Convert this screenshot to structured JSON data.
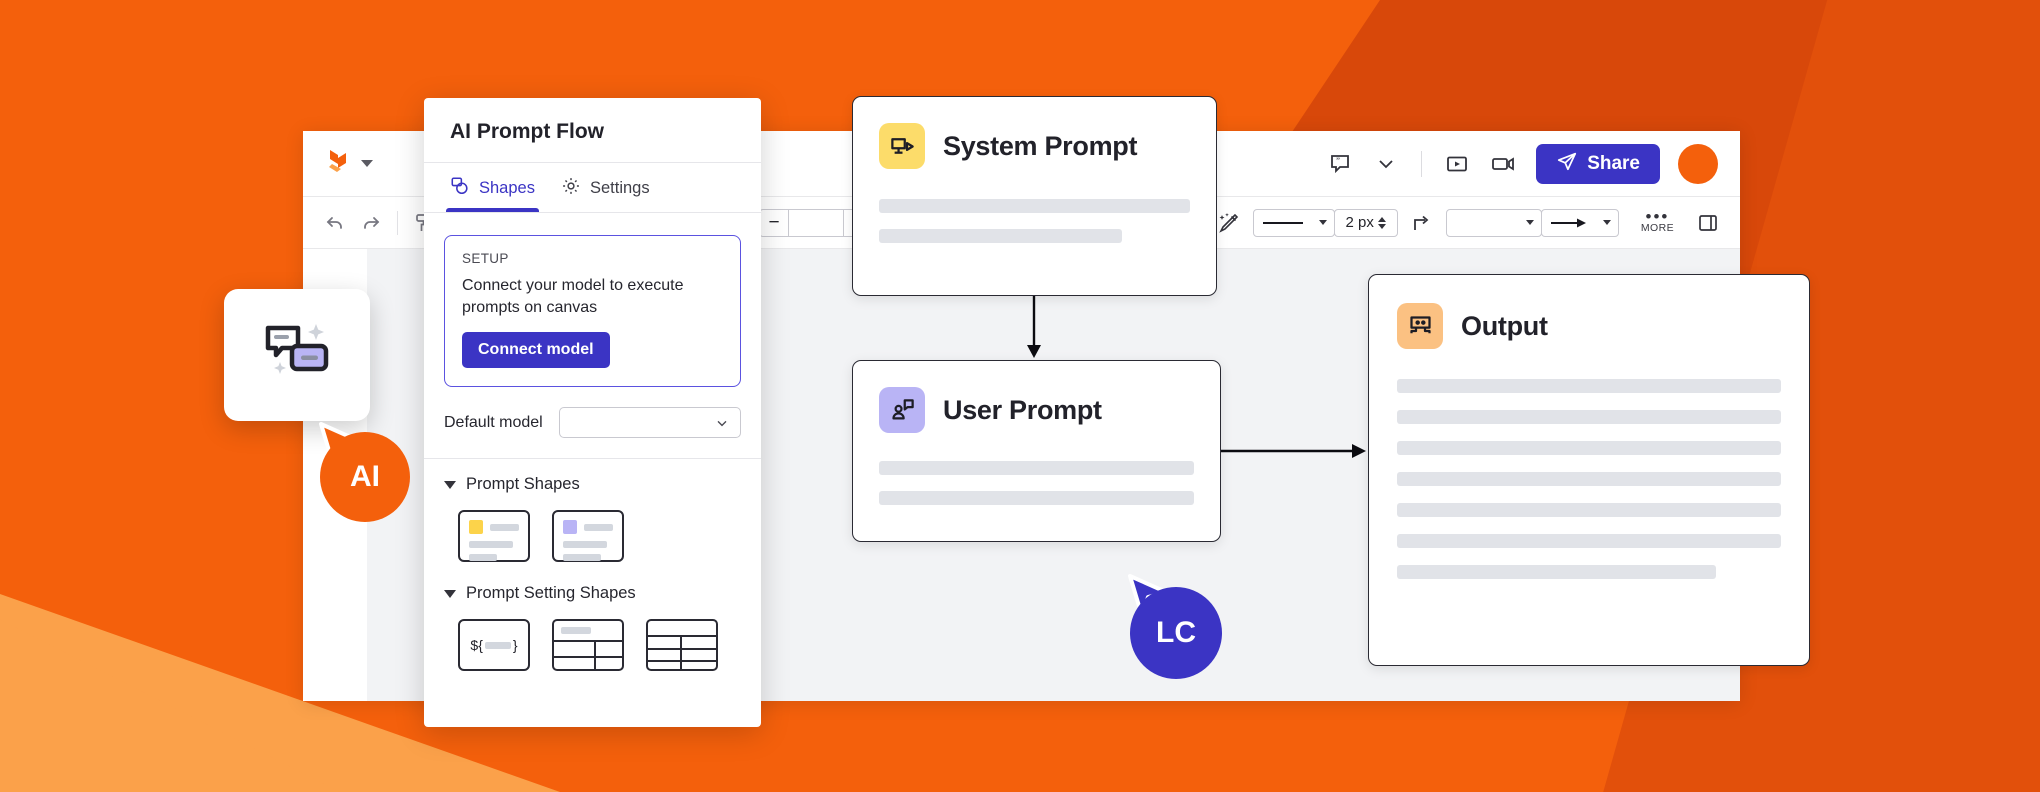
{
  "theme": {
    "brand_orange": "#F4600C",
    "brand_orange_dark": "#D8480A",
    "brand_orange_light": "#FBA14A",
    "accent_indigo": "#3B34C4",
    "badge_yellow": "#FCDC6A",
    "badge_purple": "#B9B4F5",
    "badge_peach": "#FBC182",
    "placeholder_gray": "#E1E3E8",
    "node_border": "#2A2A33"
  },
  "topbar": {
    "logo_icon": "lucid-logo-icon",
    "logo_chevron_icon": "chevron-down-icon",
    "comment_icon": "comment-icon",
    "comment_chevron_icon": "chevron-down-icon",
    "present_icon": "present-play-icon",
    "video_icon": "video-camera-icon",
    "share_label": "Share",
    "share_icon": "paper-plane-icon",
    "avatar_label": ""
  },
  "toolbar": {
    "undo_icon": "undo-arrow-icon",
    "redo_icon": "redo-arrow-icon",
    "format_painter_icon": "paint-roller-icon",
    "zoom_out_label": "−",
    "zoom_value": "",
    "zoom_in_label": "+",
    "comment_shape_icon": "comment-check-icon",
    "magic_icon": "magic-wand-icon",
    "line_style_icon": "line-style-icon",
    "line_style_caret_icon": "chevron-down-icon",
    "stroke_width": "2 px",
    "stroke_stepper_icon": "stepper-updown-icon",
    "elbow_icon": "elbow-connector-icon",
    "line_color_caret_icon": "chevron-down-icon",
    "arrow_end_icon": "arrow-right-icon",
    "arrow_end_caret_icon": "chevron-down-icon",
    "more_label": "MORE",
    "more_dots_icon": "ellipsis-icon",
    "right_panel_icon": "panel-toggle-icon"
  },
  "panel": {
    "title": "AI Prompt Flow",
    "tabs": [
      {
        "label": "Shapes",
        "icon": "shapes-icon",
        "active": true
      },
      {
        "label": "Settings",
        "icon": "gear-icon",
        "active": false
      }
    ],
    "setup": {
      "label": "SETUP",
      "description": "Connect your model to execute prompts on canvas",
      "button_label": "Connect model"
    },
    "default_model": {
      "label": "Default model",
      "value": "",
      "caret_icon": "chevron-down-icon"
    },
    "sections": [
      {
        "title": "Prompt Shapes",
        "toggle_icon": "triangle-down-icon",
        "shapes": [
          {
            "name": "system-prompt-shape",
            "accent": "#FCDC6A",
            "kind": "card"
          },
          {
            "name": "user-prompt-shape",
            "accent": "#B9B4F5",
            "kind": "card"
          }
        ]
      },
      {
        "title": "Prompt Setting Shapes",
        "toggle_icon": "triangle-down-icon",
        "shapes": [
          {
            "name": "variable-shape",
            "kind": "variable",
            "text": "${",
            "text_end": "}"
          },
          {
            "name": "table-shape",
            "kind": "table-header"
          },
          {
            "name": "data-table-shape",
            "kind": "table-plain"
          }
        ]
      }
    ]
  },
  "canvas": {
    "nodes": [
      {
        "id": "system-prompt",
        "title": "System Prompt",
        "icon": "monitor-play-icon",
        "badge_color": "#FCDC6A",
        "lines": [
          100,
          78
        ]
      },
      {
        "id": "user-prompt",
        "title": "User Prompt",
        "icon": "user-message-icon",
        "badge_color": "#B9B4F5",
        "lines": [
          100,
          100
        ]
      },
      {
        "id": "output",
        "title": "Output",
        "icon": "output-screen-icon",
        "badge_color": "#FBC182",
        "lines": [
          100,
          100,
          100,
          100,
          100,
          100,
          83
        ]
      }
    ],
    "connectors": [
      {
        "from": "system-prompt",
        "to": "user-prompt",
        "direction": "down"
      },
      {
        "from": "user-prompt",
        "to": "output",
        "direction": "right"
      }
    ],
    "preview_card_icon": "ai-prompt-sparkle-icon",
    "cursors": [
      {
        "initials": "AI",
        "color": "#F4600C"
      },
      {
        "initials": "LC",
        "color": "#3B34C4"
      }
    ]
  }
}
